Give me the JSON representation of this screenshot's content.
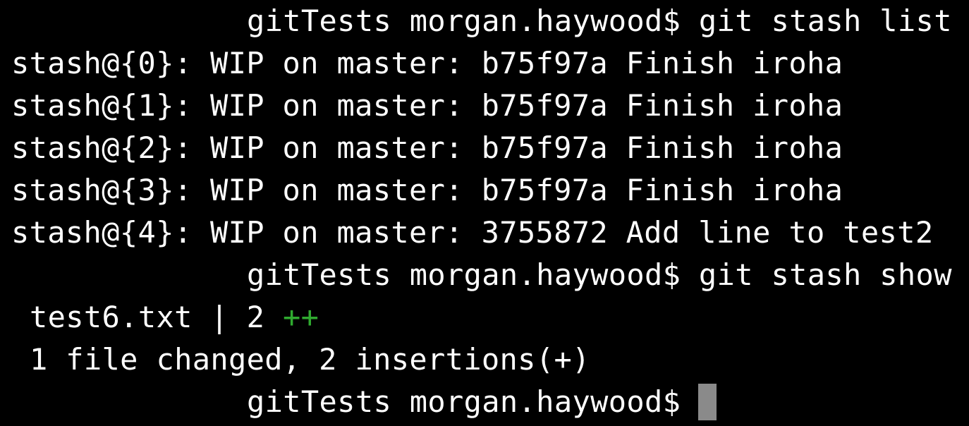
{
  "terminal": {
    "cmd1": {
      "prompt": "gitTests morgan.haywood$",
      "command": "git stash list"
    },
    "stash_list": [
      {
        "ref": "stash@{0}:",
        "branch": "WIP on master:",
        "hash": "b75f97a",
        "message": "Finish iroha"
      },
      {
        "ref": "stash@{1}:",
        "branch": "WIP on master:",
        "hash": "b75f97a",
        "message": "Finish iroha"
      },
      {
        "ref": "stash@{2}:",
        "branch": "WIP on master:",
        "hash": "b75f97a",
        "message": "Finish iroha"
      },
      {
        "ref": "stash@{3}:",
        "branch": "WIP on master:",
        "hash": "b75f97a",
        "message": "Finish iroha"
      },
      {
        "ref": "stash@{4}:",
        "branch": "WIP on master:",
        "hash": "3755872",
        "message": "Add line to test2"
      }
    ],
    "cmd2": {
      "prompt": "gitTests morgan.haywood$",
      "command": "git stash show"
    },
    "stat": {
      "file": "test6.txt",
      "separator": "|",
      "count": "2",
      "plus_marks": "++"
    },
    "summary": "1 file changed, 2 insertions(+)",
    "cmd3": {
      "prompt": "gitTests morgan.haywood$"
    }
  },
  "colors": {
    "background": "#000000",
    "text": "#ffffff",
    "insertion": "#2faa2f",
    "cursor": "#8a8a8a"
  }
}
